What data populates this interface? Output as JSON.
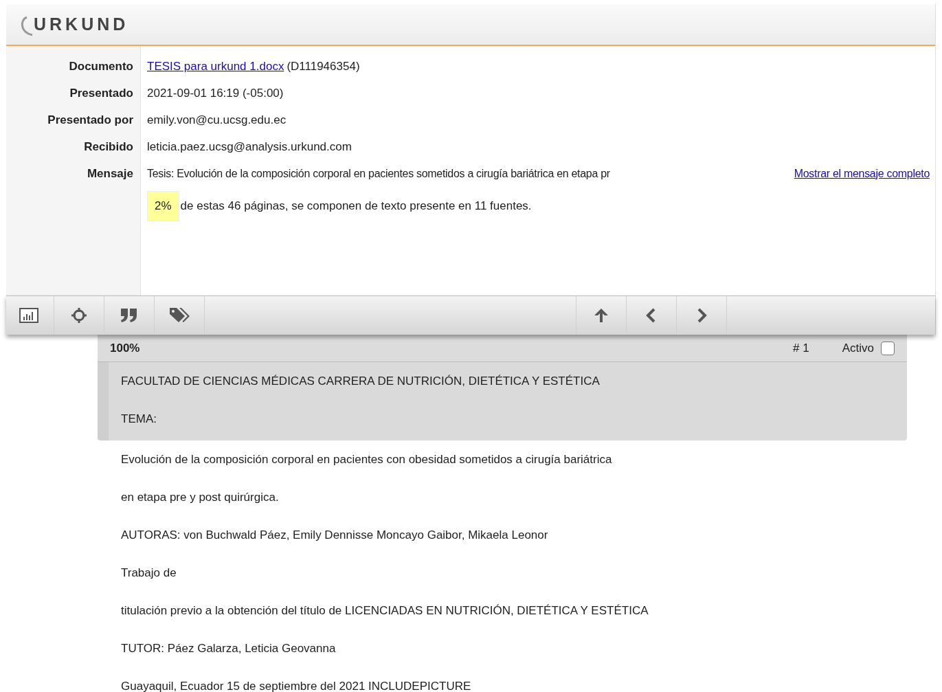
{
  "logo": {
    "text": "URKUND"
  },
  "info": [
    {
      "label": "Documento",
      "kind": "link",
      "link": "TESIS para urkund 1.docx",
      "value": "(D111946354)"
    },
    {
      "label": "Presentado",
      "kind": "text",
      "value": "2021-09-01 16:19 (-05:00)"
    },
    {
      "label": "Presentado por",
      "kind": "text",
      "value": "emily.von@cu.ucsg.edu.ec"
    },
    {
      "label": "Recibido",
      "kind": "text",
      "value": "leticia.paez.ucsg@analysis.urkund.com"
    },
    {
      "label": "Mensaje",
      "kind": "message",
      "value": "Tesis: Evolución de la composición corporal en pacientes sometidos a cirugía bariátrica en etapa pr",
      "link": "Mostrar el mensaje completo"
    }
  ],
  "summary": {
    "percent": "2%",
    "text": "de estas 46 páginas, se componen de texto presente en 11 fuentes."
  },
  "source_bar": {
    "zoom": "100%",
    "number": "# 1",
    "active_label": "Activo",
    "active_checked": false
  },
  "highlighted_lines": [
    "FACULTAD DE CIENCIAS MÉDICAS CARRERA DE NUTRICIÓN, DIETÉTICA Y ESTÉTICA",
    "TEMA:"
  ],
  "document_lines": [
    "Evolución de la composición corporal en pacientes con obesidad sometidos a cirugía bariátrica",
    "en etapa pre y post quirúrgica.",
    "AUTORAS: von Buchwald Páez, Emily Dennisse Moncayo Gaibor, Mikaela Leonor",
    "Trabajo de",
    "titulación previo a la obtención del título de LICENCIADAS EN NUTRICIÓN, DIETÉTICA Y ESTÉTICA",
    "TUTOR: Páez Galarza, Leticia Geovanna",
    "Guayaquil, Ecuador 15 de septiembre del 2021 INCLUDEPICTURE"
  ]
}
